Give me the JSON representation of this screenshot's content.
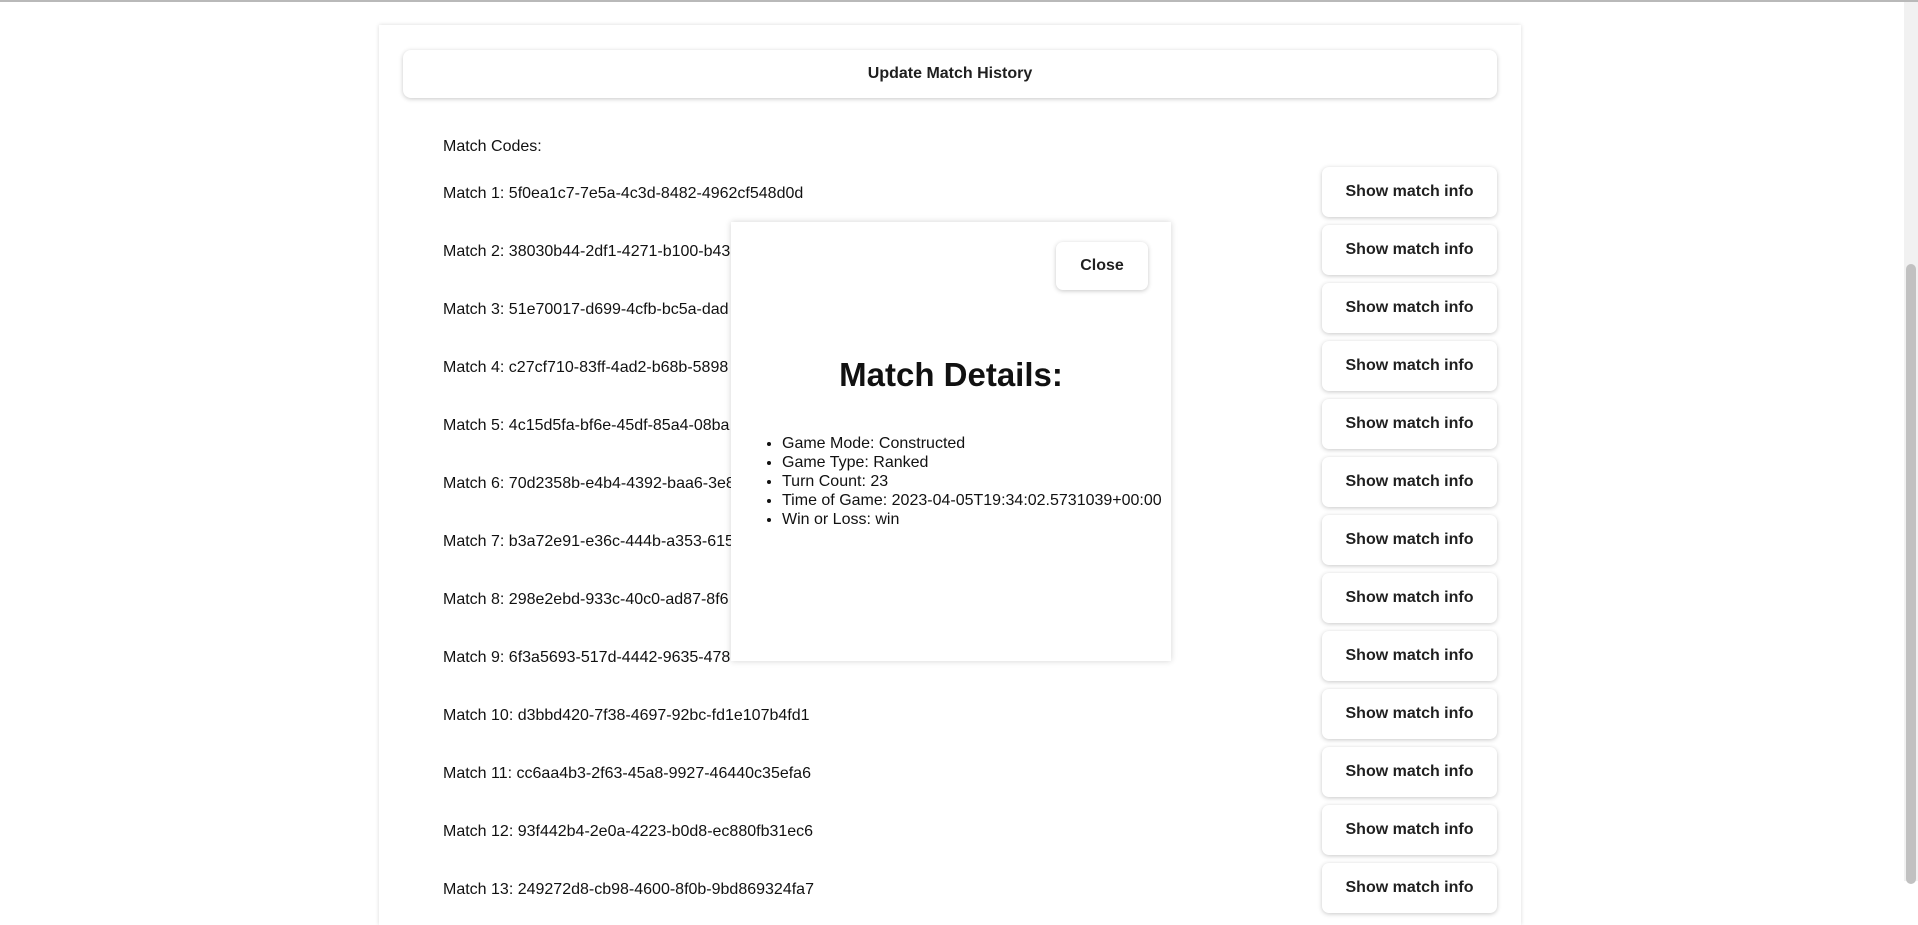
{
  "header": {
    "update_label": "Update Match History"
  },
  "codes_label": "Match Codes:",
  "match_button_label": "Show match info",
  "matches": [
    {
      "label": "Match 1: 5f0ea1c7-7e5a-4c3d-8482-4962cf548d0d"
    },
    {
      "label": "Match 2: 38030b44-2df1-4271-b100-b43"
    },
    {
      "label": "Match 3: 51e70017-d699-4cfb-bc5a-dad"
    },
    {
      "label": "Match 4: c27cf710-83ff-4ad2-b68b-5898"
    },
    {
      "label": "Match 5: 4c15d5fa-bf6e-45df-85a4-08ba"
    },
    {
      "label": "Match 6: 70d2358b-e4b4-4392-baa6-3e8"
    },
    {
      "label": "Match 7: b3a72e91-e36c-444b-a353-615"
    },
    {
      "label": "Match 8: 298e2ebd-933c-40c0-ad87-8f6"
    },
    {
      "label": "Match 9: 6f3a5693-517d-4442-9635-478"
    },
    {
      "label": "Match 10: d3bbd420-7f38-4697-92bc-fd1e107b4fd1"
    },
    {
      "label": "Match 11: cc6aa4b3-2f63-45a8-9927-46440c35efa6"
    },
    {
      "label": "Match 12: 93f442b4-2e0a-4223-b0d8-ec880fb31ec6"
    },
    {
      "label": "Match 13: 249272d8-cb98-4600-8f0b-9bd869324fa7"
    }
  ],
  "modal": {
    "close_label": "Close",
    "title": "Match Details:",
    "details": [
      "Game Mode: Constructed",
      "Game Type: Ranked",
      "Turn Count: 23",
      "Time of Game: 2023-04-05T19:34:02.5731039+00:00",
      "Win or Loss: win"
    ]
  }
}
